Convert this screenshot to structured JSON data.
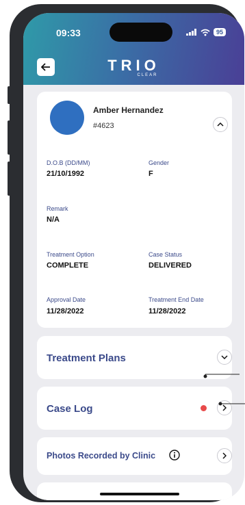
{
  "status_bar": {
    "time": "09:33",
    "battery": "95"
  },
  "header": {
    "logo_text": "TRIO",
    "logo_sub": "CLEAR"
  },
  "patient": {
    "name": "Amber Hernandez",
    "id": "#4623",
    "fields": [
      {
        "label": "D.O.B (DD/MM)",
        "value": "21/10/1992"
      },
      {
        "label": "Gender",
        "value": "F"
      },
      {
        "label": "Remark",
        "value": "N/A"
      },
      {
        "label": "Treatment Option",
        "value": "COMPLETE"
      },
      {
        "label": "Case Status",
        "value": "DELIVERED"
      },
      {
        "label": "Approval Date",
        "value": "11/28/2022"
      },
      {
        "label": "Treatment End Date",
        "value": "11/28/2022"
      }
    ]
  },
  "sections": [
    {
      "title": "Treatment Plans"
    },
    {
      "title": "Case Log"
    },
    {
      "title": "Photos Recorded by Clinic"
    }
  ]
}
